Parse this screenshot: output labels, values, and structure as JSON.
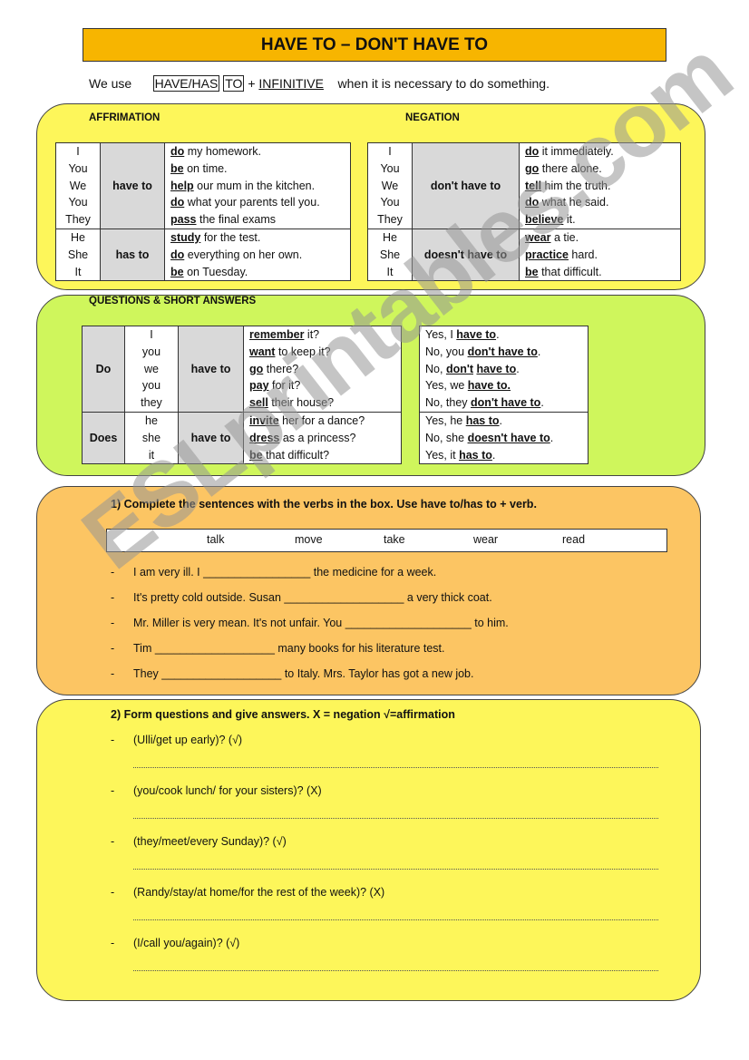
{
  "title": "HAVE TO – DON'T HAVE TO",
  "intro": {
    "lead": "We use",
    "box1": "HAVE/HAS",
    "box2": "TO",
    "plus": "+",
    "infinitive": "INFINITIVE",
    "tail": "when it is necessary to do something."
  },
  "colors": {
    "title_bg": "#f7b500",
    "panel_yellow": "#fdf65a",
    "panel_green": "#cff65c",
    "panel_orange": "#fcc563",
    "cell_gray": "#d9d9d9"
  },
  "affirmation": {
    "label": "AFFRIMATION",
    "groups": [
      {
        "subjects": [
          "I",
          "You",
          "We",
          "You",
          "They"
        ],
        "aux": "have to",
        "lines": [
          {
            "v": "do",
            "r": " my homework."
          },
          {
            "v": "be",
            "r": " on time."
          },
          {
            "v": "help",
            "r": " our mum in the kitchen."
          },
          {
            "v": "do",
            "r": " what your parents tell you."
          },
          {
            "v": "pass",
            "r": " the final exams"
          }
        ]
      },
      {
        "subjects": [
          "He",
          "She",
          "It"
        ],
        "aux": "has to",
        "lines": [
          {
            "v": "study",
            "r": " for the test."
          },
          {
            "v": "do",
            "r": " everything on her own."
          },
          {
            "v": "be",
            "r": " on Tuesday."
          }
        ]
      }
    ]
  },
  "negation": {
    "label": "NEGATION",
    "groups": [
      {
        "subjects": [
          "I",
          "You",
          "We",
          "You",
          "They"
        ],
        "aux": "don't have to",
        "lines": [
          {
            "v": "do",
            "r": " it immediately."
          },
          {
            "v": "go",
            "r": " there alone."
          },
          {
            "v": "tell",
            "r": " him the truth."
          },
          {
            "v": "do",
            "r": " what he said."
          },
          {
            "v": "believe",
            "r": " it."
          }
        ]
      },
      {
        "subjects": [
          "He",
          "She",
          "It"
        ],
        "aux": "doesn't have to",
        "lines": [
          {
            "v": "wear",
            "r": " a tie."
          },
          {
            "v": "practice",
            "r": " hard."
          },
          {
            "v": "be",
            "r": " that difficult."
          }
        ]
      }
    ]
  },
  "questions": {
    "label": "QUESTIONS & SHORT ANSWERS",
    "groups": [
      {
        "aux": "Do",
        "subjects": [
          "I",
          "you",
          "we",
          "you",
          "they"
        ],
        "verb": "have to",
        "lines": [
          {
            "v": "remember",
            "r": " it?"
          },
          {
            "v": "want",
            "r": " to keep it?"
          },
          {
            "v": "go",
            "r": " there?"
          },
          {
            "v": "pay",
            "r": " for it?"
          },
          {
            "v": "sell",
            "r": " their house?"
          }
        ],
        "answers": [
          [
            {
              "t": "Yes, I "
            },
            {
              "t": "have to",
              "b": true
            },
            {
              "t": "."
            }
          ],
          [
            {
              "t": "No, you "
            },
            {
              "t": "don't have to",
              "b": true
            },
            {
              "t": "."
            }
          ],
          [
            {
              "t": "No, "
            },
            {
              "t": "don't",
              "b": true
            },
            {
              "t": " "
            },
            {
              "t": "have to",
              "b": true
            },
            {
              "t": "."
            }
          ],
          [
            {
              "t": "Yes, we "
            },
            {
              "t": "have to.",
              "b": true
            }
          ],
          [
            {
              "t": "No, they "
            },
            {
              "t": "don't have to",
              "b": true
            },
            {
              "t": "."
            }
          ]
        ]
      },
      {
        "aux": "Does",
        "subjects": [
          "he",
          "she",
          "it"
        ],
        "verb": "have to",
        "lines": [
          {
            "v": "invite",
            "r": " her for a dance?"
          },
          {
            "v": "dress",
            "r": " as a princess?"
          },
          {
            "v": "be",
            "r": " that difficult?"
          }
        ],
        "answers": [
          [
            {
              "t": "Yes, he "
            },
            {
              "t": "has to",
              "b": true
            },
            {
              "t": "."
            }
          ],
          [
            {
              "t": "No, she "
            },
            {
              "t": "doesn't have to",
              "b": true
            },
            {
              "t": "."
            }
          ],
          [
            {
              "t": "Yes, it "
            },
            {
              "t": "has to",
              "b": true
            },
            {
              "t": "."
            }
          ]
        ]
      }
    ]
  },
  "exercise1": {
    "instruction": "1)   Complete the sentences with the verbs in the box. Use have to/has to + verb.",
    "words": [
      "talk",
      "move",
      "take",
      "wear",
      "read"
    ],
    "dash": "-",
    "sentences": [
      "I am very ill. I _________________ the medicine for a week.",
      "It's pretty cold outside. Susan ___________________ a very thick coat.",
      "Mr.  Miller is very mean. It's not unfair. You ____________________ to him.",
      "Tim ___________________ many books for his literature test.",
      "They ___________________ to Italy. Mrs. Taylor has got a new job."
    ]
  },
  "exercise2": {
    "instruction": "2)   Form questions and give answers. X = negation  √=affirmation",
    "dash": "-",
    "items": [
      "(Ulli/get up early)? (√)",
      "(you/cook lunch/ for your sisters)? (X)",
      "(they/meet/every Sunday)? (√)",
      "(Randy/stay/at home/for the rest of the week)? (X)",
      "(I/call you/again)? (√)"
    ]
  },
  "watermark": "ESLprintables.com"
}
